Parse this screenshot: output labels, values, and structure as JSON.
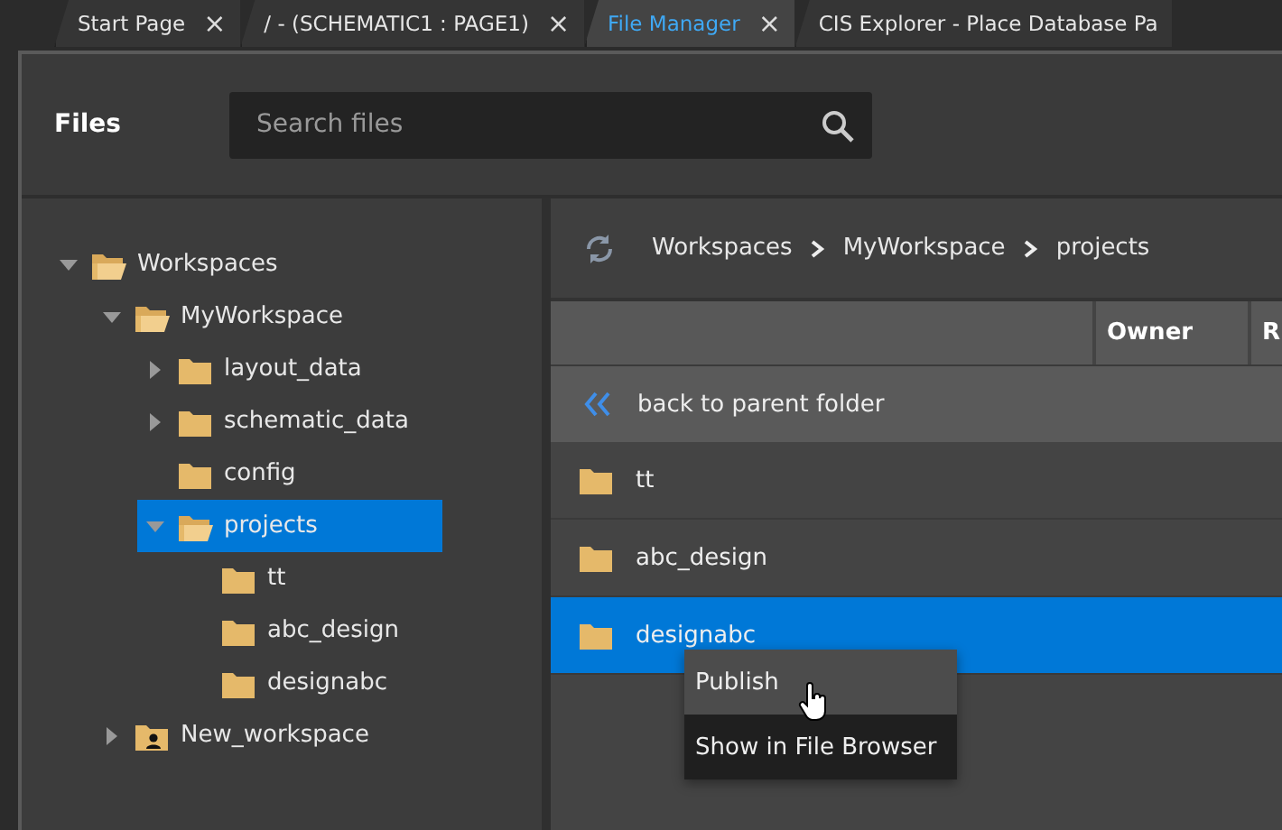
{
  "tabs": [
    {
      "label": "Start Page",
      "close": "×",
      "selected": false
    },
    {
      "label": "/ - (SCHEMATIC1 : PAGE1)",
      "close": "×",
      "selected": false
    },
    {
      "label": "File Manager",
      "close": "×",
      "selected": true
    },
    {
      "label": "CIS Explorer - Place Database Pa",
      "selected": false
    }
  ],
  "header": {
    "title": "Files",
    "search": {
      "placeholder": "Search files"
    }
  },
  "tree": [
    {
      "label": "Workspaces",
      "kind": "open",
      "expanded": true,
      "selected": false,
      "children": [
        {
          "label": "MyWorkspace",
          "kind": "open",
          "expanded": true,
          "selected": false,
          "children": [
            {
              "label": "layout_data",
              "kind": "closed",
              "expanded": false,
              "selected": false
            },
            {
              "label": "schematic_data",
              "kind": "closed",
              "expanded": false,
              "selected": false
            },
            {
              "label": "config",
              "kind": "closed",
              "selected": false
            },
            {
              "label": "projects",
              "kind": "open",
              "expanded": true,
              "selected": true,
              "children": [
                {
                  "label": "tt",
                  "kind": "closed",
                  "selected": false
                },
                {
                  "label": "abc_design",
                  "kind": "closed",
                  "selected": false
                },
                {
                  "label": "designabc",
                  "kind": "closed",
                  "selected": false
                }
              ]
            }
          ]
        },
        {
          "label": "New_workspace",
          "kind": "user",
          "expanded": false,
          "selected": false
        }
      ]
    }
  ],
  "breadcrumb": [
    "Workspaces",
    "MyWorkspace",
    "projects"
  ],
  "table": {
    "columns": [
      {
        "label": "Owner"
      },
      {
        "label": "R"
      }
    ],
    "back": "back to parent folder",
    "rows": [
      {
        "name": "tt",
        "selected": false
      },
      {
        "name": "abc_design",
        "selected": false
      },
      {
        "name": "designabc",
        "selected": true
      }
    ]
  },
  "context_menu": [
    {
      "label": "Publish",
      "selected": true
    },
    {
      "label": "Show in File Browser",
      "selected": false
    }
  ]
}
